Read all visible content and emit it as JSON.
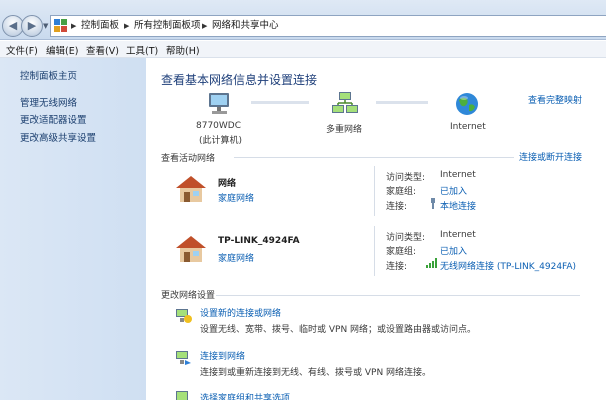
{
  "breadcrumb": [
    "控制面板",
    "所有控制面板项",
    "网络和共享中心"
  ],
  "menu": [
    "文件(F)",
    "编辑(E)",
    "查看(V)",
    "工具(T)",
    "帮助(H)"
  ],
  "sidebar": {
    "home": "控制面板主页",
    "items": [
      "管理无线网络",
      "更改适配器设置",
      "更改高级共享设置"
    ]
  },
  "main": {
    "title": "查看基本网络信息并设置连接",
    "full_map": "查看完整映射",
    "map": {
      "computer": "8770WDC",
      "computer_sub": "(此计算机)",
      "network": "多重网络",
      "internet": "Internet"
    },
    "active_title": "查看活动网络",
    "connect_disconnect": "连接或断开连接",
    "networks": [
      {
        "name": "网络",
        "type": "家庭网络",
        "access_label": "访问类型:",
        "access_value": "Internet",
        "homegroup_label": "家庭组:",
        "homegroup_value": "已加入",
        "conn_label": "连接:",
        "conn_value": "本地连接"
      },
      {
        "name": "TP-LINK_4924FA",
        "type": "家庭网络",
        "access_label": "访问类型:",
        "access_value": "Internet",
        "homegroup_label": "家庭组:",
        "homegroup_value": "已加入",
        "conn_label": "连接:",
        "conn_value": "无线网络连接 (TP-LINK_4924FA)"
      }
    ],
    "change_title": "更改网络设置",
    "tasks": [
      {
        "title": "设置新的连接或网络",
        "desc": "设置无线、宽带、拨号、临时或 VPN 网络；或设置路由器或访问点。"
      },
      {
        "title": "连接到网络",
        "desc": "连接到或重新连接到无线、有线、拨号或 VPN 网络连接。"
      },
      {
        "title": "选择家庭组和共享选项",
        "desc": ""
      }
    ]
  }
}
